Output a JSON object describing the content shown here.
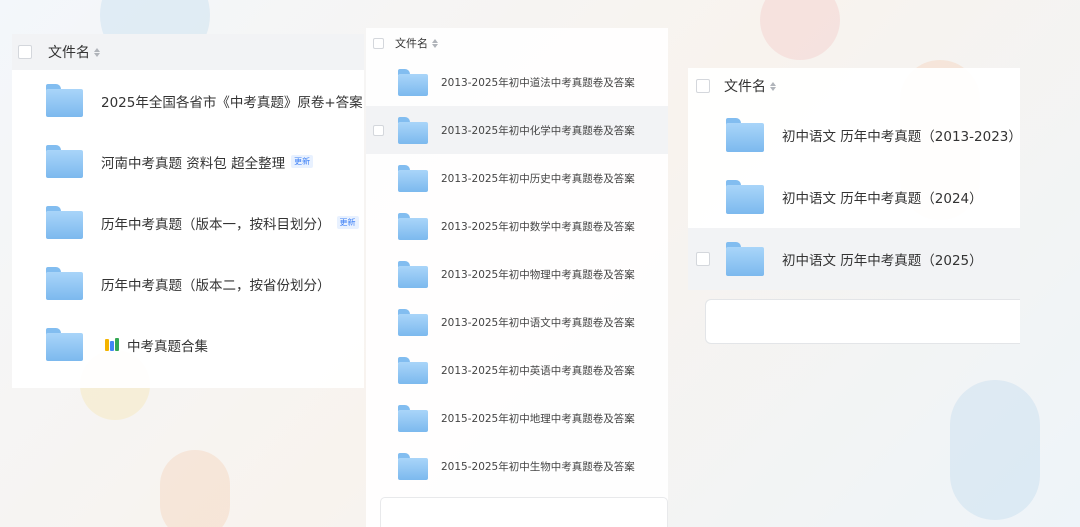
{
  "panel1": {
    "header": {
      "label": "文件名"
    },
    "rows": [
      {
        "label": "2025年全国各省市《中考真题》原卷+答案",
        "badge": ""
      },
      {
        "label": "河南中考真题 资料包  超全整理",
        "badge": "更新"
      },
      {
        "label": "历年中考真题（版本一，按科目划分）",
        "badge": "更新"
      },
      {
        "label": "历年中考真题（版本二，按省份划分）",
        "badge": ""
      },
      {
        "label": "中考真题合集",
        "badge": "",
        "app_icon": "colorful-app-icon"
      }
    ]
  },
  "panel2": {
    "header": {
      "label": "文件名"
    },
    "rows": [
      {
        "label": "2013-2025年初中道法中考真题卷及答案"
      },
      {
        "label": "2013-2025年初中化学中考真题卷及答案"
      },
      {
        "label": "2013-2025年初中历史中考真题卷及答案"
      },
      {
        "label": "2013-2025年初中数学中考真题卷及答案"
      },
      {
        "label": "2013-2025年初中物理中考真题卷及答案"
      },
      {
        "label": "2013-2025年初中语文中考真题卷及答案"
      },
      {
        "label": "2013-2025年初中英语中考真题卷及答案"
      },
      {
        "label": "2015-2025年初中地理中考真题卷及答案"
      },
      {
        "label": "2015-2025年初中生物中考真题卷及答案"
      }
    ]
  },
  "panel3": {
    "header": {
      "label": "文件名"
    },
    "rows": [
      {
        "label": "初中语文 历年中考真题（2013-2023）"
      },
      {
        "label": "初中语文 历年中考真题（2024）"
      },
      {
        "label": "初中语文 历年中考真题（2025）"
      }
    ]
  },
  "icons": {
    "folder": "folder-icon",
    "sort": "sort-icon",
    "checkbox": "checkbox"
  },
  "colors": {
    "folder_light": "#a9d5f9",
    "folder_dark": "#7cb9ee",
    "badge_text": "#3a7ef6",
    "header_bg": "#f2f3f5"
  }
}
